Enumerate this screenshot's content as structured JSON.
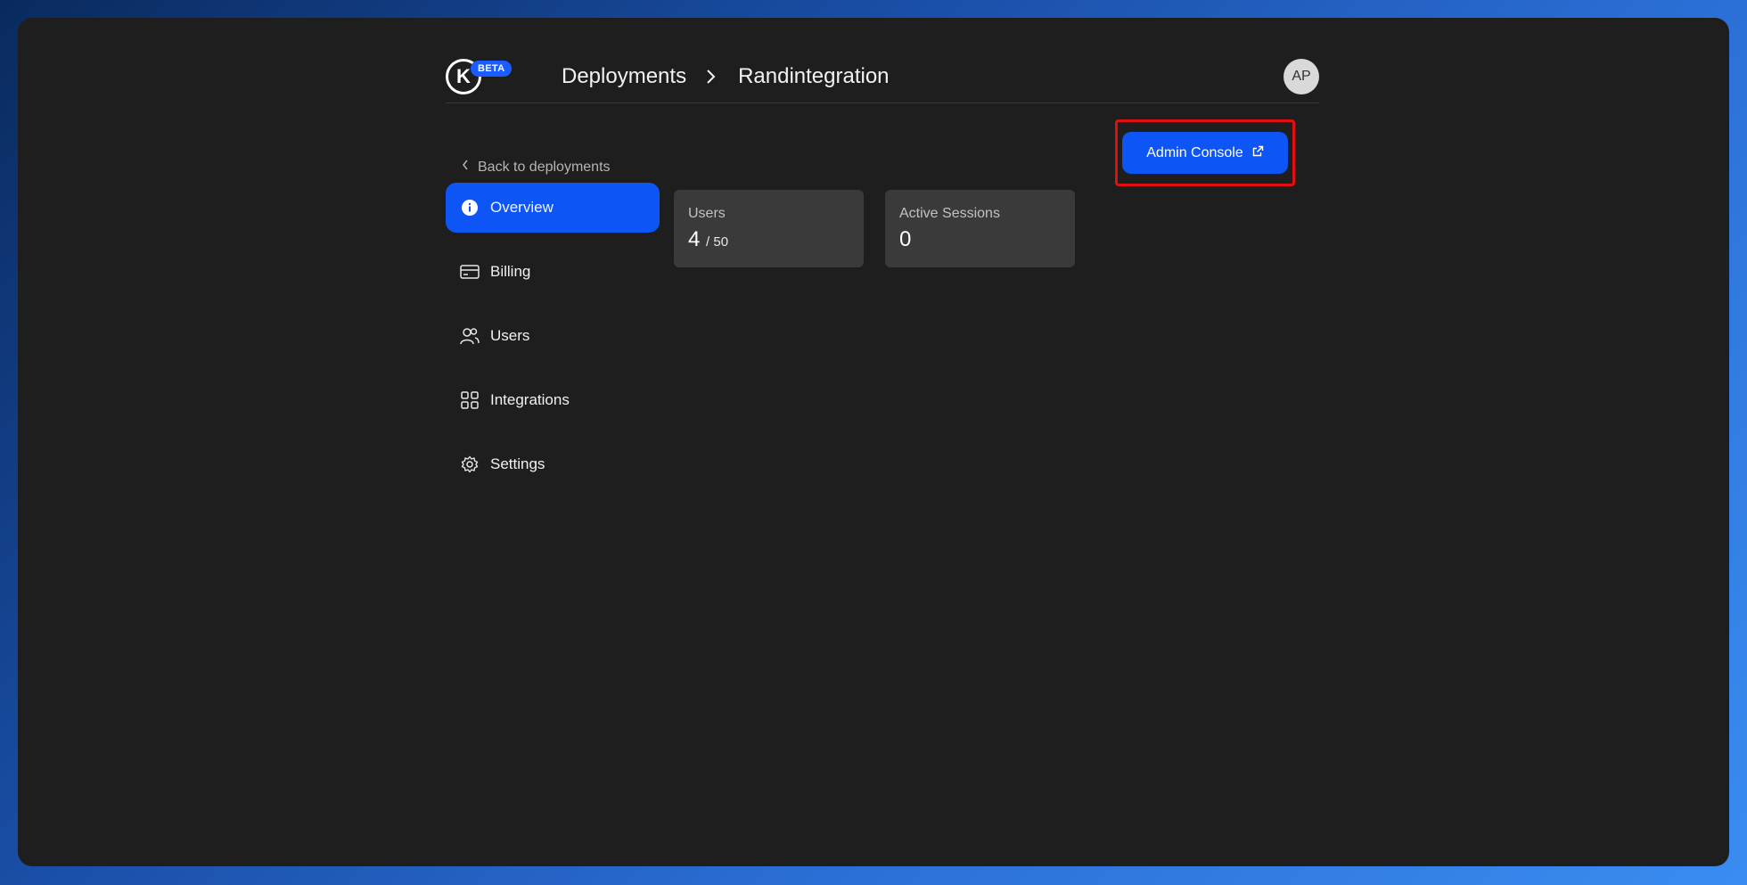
{
  "header": {
    "logo_letter": "K",
    "beta_label": "BETA",
    "breadcrumb": [
      "Deployments",
      "Randintegration"
    ],
    "avatar_initials": "AP"
  },
  "back_link": "Back to deployments",
  "sidebar": {
    "items": [
      {
        "label": "Overview",
        "icon": "info-icon",
        "active": true
      },
      {
        "label": "Billing",
        "icon": "credit-card-icon"
      },
      {
        "label": "Users",
        "icon": "users-icon"
      },
      {
        "label": "Integrations",
        "icon": "grid-icon"
      },
      {
        "label": "Settings",
        "icon": "gear-icon"
      }
    ]
  },
  "stats": [
    {
      "label": "Users",
      "value": "4",
      "sub": "/ 50"
    },
    {
      "label": "Active Sessions",
      "value": "0",
      "sub": ""
    }
  ],
  "admin_button": {
    "label": "Admin Console",
    "icon": "external-link-icon"
  },
  "colors": {
    "accent": "#0d55f5",
    "highlight": "#e01010",
    "background": "#1e1e1e",
    "card": "#3a3a3a"
  }
}
